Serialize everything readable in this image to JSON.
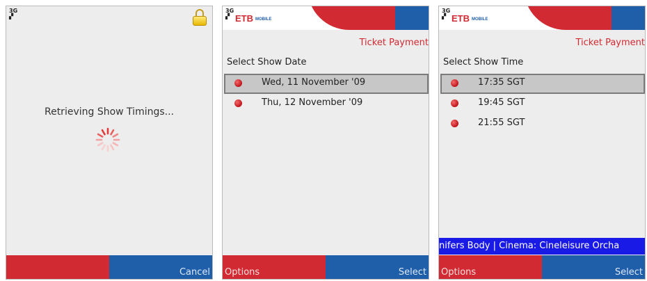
{
  "screen1": {
    "network": "3G",
    "message": "Retrieving Show Timings...",
    "softkeys": {
      "left": "",
      "right": "Cancel"
    }
  },
  "screen2": {
    "network": "3G",
    "logo": "ETB",
    "logo_sub": "MOBILE",
    "title": "Ticket Payment",
    "prompt": "Select Show Date",
    "items": [
      {
        "label": "Wed, 11 November '09",
        "selected": true
      },
      {
        "label": "Thu, 12 November '09",
        "selected": false
      }
    ],
    "softkeys": {
      "left": "Options",
      "right": "Select"
    }
  },
  "screen3": {
    "network": "3G",
    "logo": "ETB",
    "logo_sub": "MOBILE",
    "title": "Ticket Payment",
    "prompt": "Select Show Time",
    "items": [
      {
        "label": "17:35 SGT",
        "selected": true
      },
      {
        "label": "19:45 SGT",
        "selected": false
      },
      {
        "label": "21:55 SGT",
        "selected": false
      }
    ],
    "ticker": "nifers Body | Cinema: Cineleisure Orcha",
    "softkeys": {
      "left": "Options",
      "right": "Select"
    }
  },
  "colors": {
    "red": "#d12a32",
    "blue": "#1f5ea8",
    "ticker": "#1a1ae6",
    "background": "#ededed"
  }
}
